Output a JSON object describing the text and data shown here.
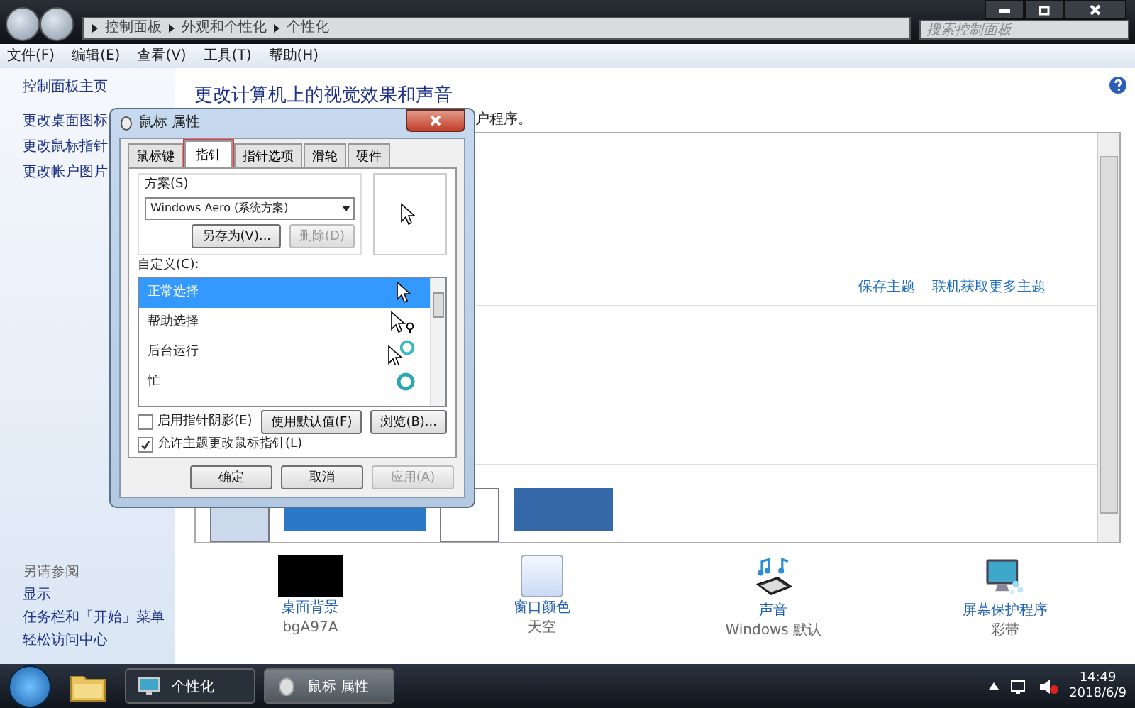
{
  "window": {
    "breadcrumb": [
      "控制面板",
      "外观和个性化",
      "个性化"
    ],
    "search_placeholder": "搜索控制面板"
  },
  "menu": [
    "文件(F)",
    "编辑(E)",
    "查看(V)",
    "工具(T)",
    "帮助(H)"
  ],
  "sidebar": {
    "items": [
      "控制面板主页",
      "更改桌面图标",
      "更改鼠标指针",
      "更改帐户图片"
    ],
    "see_also_title": "另请参阅",
    "see_also": [
      "显示",
      "任务栏和「开始」菜单",
      "轻松访问中心"
    ]
  },
  "main": {
    "title": "更改计算机上的视觉效果和声音",
    "subtitle": "户程序。",
    "theme_links": [
      "保存主题",
      "联机获取更多主题"
    ],
    "settings": [
      {
        "kind": "background",
        "label": "桌面背景",
        "value": "bgA97A"
      },
      {
        "kind": "color",
        "label": "窗口颜色",
        "value": "天空"
      },
      {
        "kind": "sound",
        "label": "声音",
        "value": "Windows 默认"
      },
      {
        "kind": "screensaver",
        "label": "屏幕保护程序",
        "value": "彩带"
      }
    ]
  },
  "dialog": {
    "title": "鼠标 属性",
    "tabs": [
      {
        "label": "鼠标键",
        "selected": false
      },
      {
        "label": "指针",
        "selected": true
      },
      {
        "label": "指针选项",
        "selected": false
      },
      {
        "label": "滑轮",
        "selected": false
      },
      {
        "label": "硬件",
        "selected": false
      }
    ],
    "scheme_label": "方案(S)",
    "scheme_value": "Windows Aero (系统方案)",
    "save_as": "另存为(V)...",
    "delete": {
      "label": "删除(D)",
      "disabled": true
    },
    "customize_label": "自定义(C):",
    "pointers": [
      {
        "name": "正常选择",
        "kind": "arrow",
        "selected": true
      },
      {
        "name": "帮助选择",
        "kind": "help",
        "selected": false
      },
      {
        "name": "后台运行",
        "kind": "working",
        "selected": false
      },
      {
        "name": "忙",
        "kind": "busy",
        "selected": false
      }
    ],
    "options": [
      {
        "label": "启用指针阴影(E)",
        "checked": false
      },
      {
        "label": "允许主题更改鼠标指针(L)",
        "checked": true
      }
    ],
    "default_button": "使用默认值(F)",
    "browse_button": "浏览(B)...",
    "buttons": [
      {
        "label": "确定",
        "disabled": false
      },
      {
        "label": "取消",
        "disabled": false
      },
      {
        "label": "应用(A)",
        "disabled": true
      }
    ]
  },
  "taskbar": {
    "buttons": [
      {
        "label": "个性化",
        "selected": false
      },
      {
        "label": "鼠标 属性",
        "selected": true
      }
    ],
    "time": "14:49",
    "date": "2018/6/9"
  }
}
